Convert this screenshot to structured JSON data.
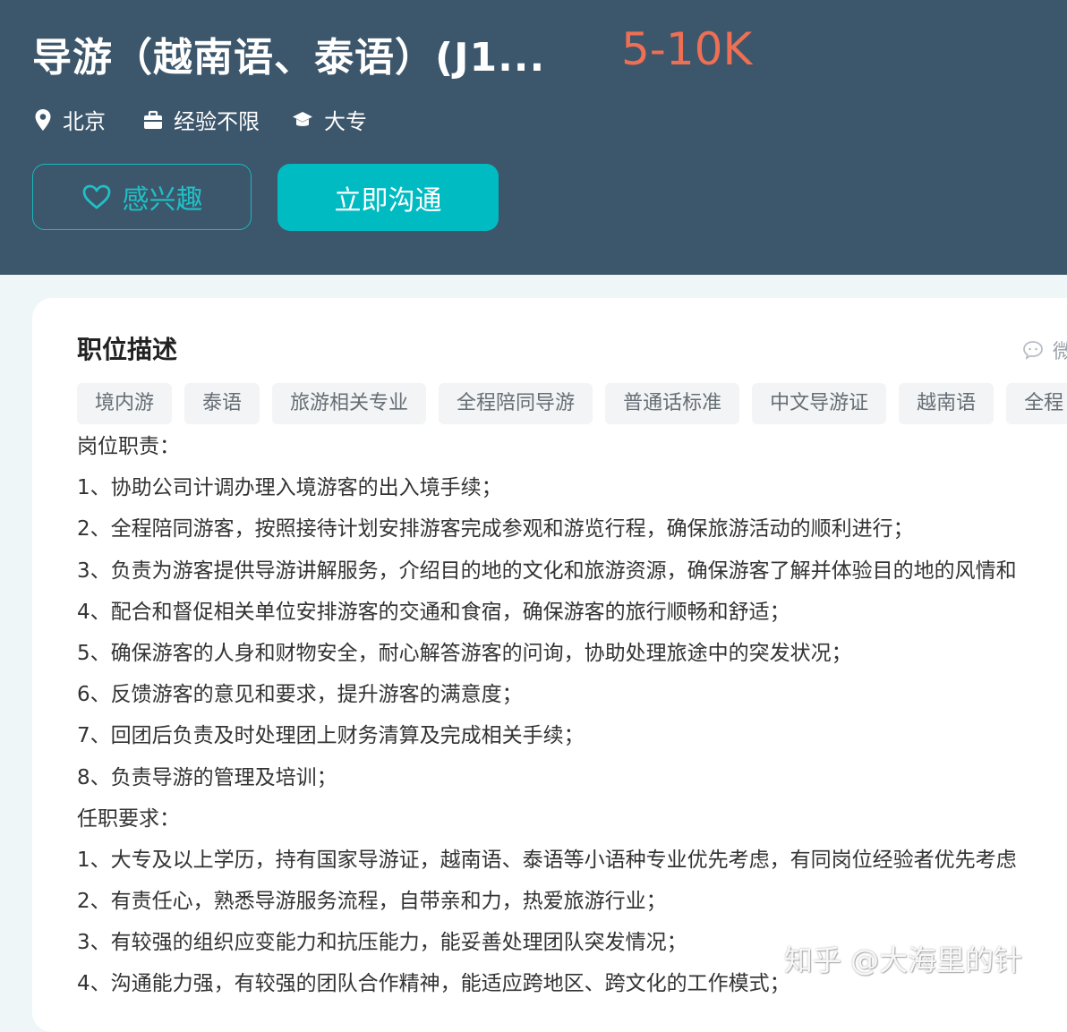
{
  "job": {
    "title": "导游（越南语、泰语）(J1...",
    "salary": "5-10K",
    "location": "北京",
    "experience": "经验不限",
    "education": "大专"
  },
  "actions": {
    "interest_label": "感兴趣",
    "chat_label": "立即沟通"
  },
  "description": {
    "title": "职位描述",
    "wechat_label": "微",
    "tags": [
      "境内游",
      "泰语",
      "旅游相关专业",
      "全程陪同导游",
      "普通话标准",
      "中文导游证",
      "越南语",
      "全程"
    ],
    "lines": [
      "岗位职责：",
      "1、协助公司计调办理入境游客的出入境手续；",
      "2、全程陪同游客，按照接待计划安排游客完成参观和游览行程，确保旅游活动的顺利进行；",
      "3、负责为游客提供导游讲解服务，介绍目的地的文化和旅游资源，确保游客了解并体验目的地的风情和",
      "4、配合和督促相关单位安排游客的交通和食宿，确保游客的旅行顺畅和舒适；",
      "5、确保游客的人身和财物安全，耐心解答游客的问询，协助处理旅途中的突发状况；",
      "6、反馈游客的意见和要求，提升游客的满意度；",
      "7、回团后负责及时处理团上财务清算及完成相关手续；",
      "8、负责导游的管理及培训；",
      "任职要求：",
      "1、大专及以上学历，持有国家导游证，越南语、泰语等小语种专业优先考虑，有同岗位经验者优先考虑",
      "2、有责任心，熟悉导游服务流程，自带亲和力，热爱旅游行业；",
      "3、有较强的组织应变能力和抗压能力，能妥善处理团队突发情况；",
      "4、沟通能力强，有较强的团队合作精神，能适应跨地区、跨文化的工作模式；"
    ]
  },
  "watermark": "知乎 @大海里的针",
  "colors": {
    "header_bg": "#3c566b",
    "salary": "#ee6f53",
    "accent": "#00bcc2"
  },
  "icons": {
    "location": "location-pin-icon",
    "experience": "briefcase-icon",
    "education": "graduation-cap-icon",
    "interest": "heart-icon",
    "wechat": "chat-bubble-icon"
  }
}
